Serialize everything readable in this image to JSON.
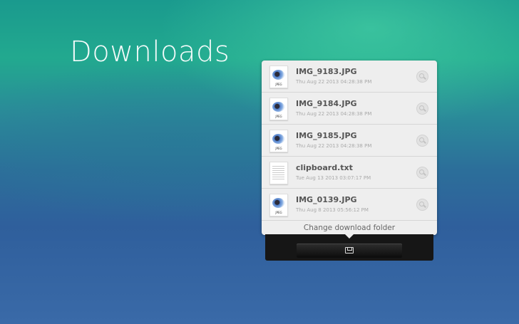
{
  "title": "Downloads",
  "files": [
    {
      "name": "IMG_9183.JPG",
      "date": "Thu Aug 22 2013 04:28:38 PM",
      "type": "jpg",
      "ext": "JPEG"
    },
    {
      "name": "IMG_9184.JPG",
      "date": "Thu Aug 22 2013 04:28:38 PM",
      "type": "jpg",
      "ext": "JPEG"
    },
    {
      "name": "IMG_9185.JPG",
      "date": "Thu Aug 22 2013 04:28:38 PM",
      "type": "jpg",
      "ext": "JPEG"
    },
    {
      "name": "clipboard.txt",
      "date": "Tue Aug 13 2013 03:07:17 PM",
      "type": "txt"
    },
    {
      "name": "IMG_0139.JPG",
      "date": "Thu Aug 8 2013 05:56:12 PM",
      "type": "jpg",
      "ext": "JPEG"
    }
  ],
  "change_folder_label": "Change download folder"
}
